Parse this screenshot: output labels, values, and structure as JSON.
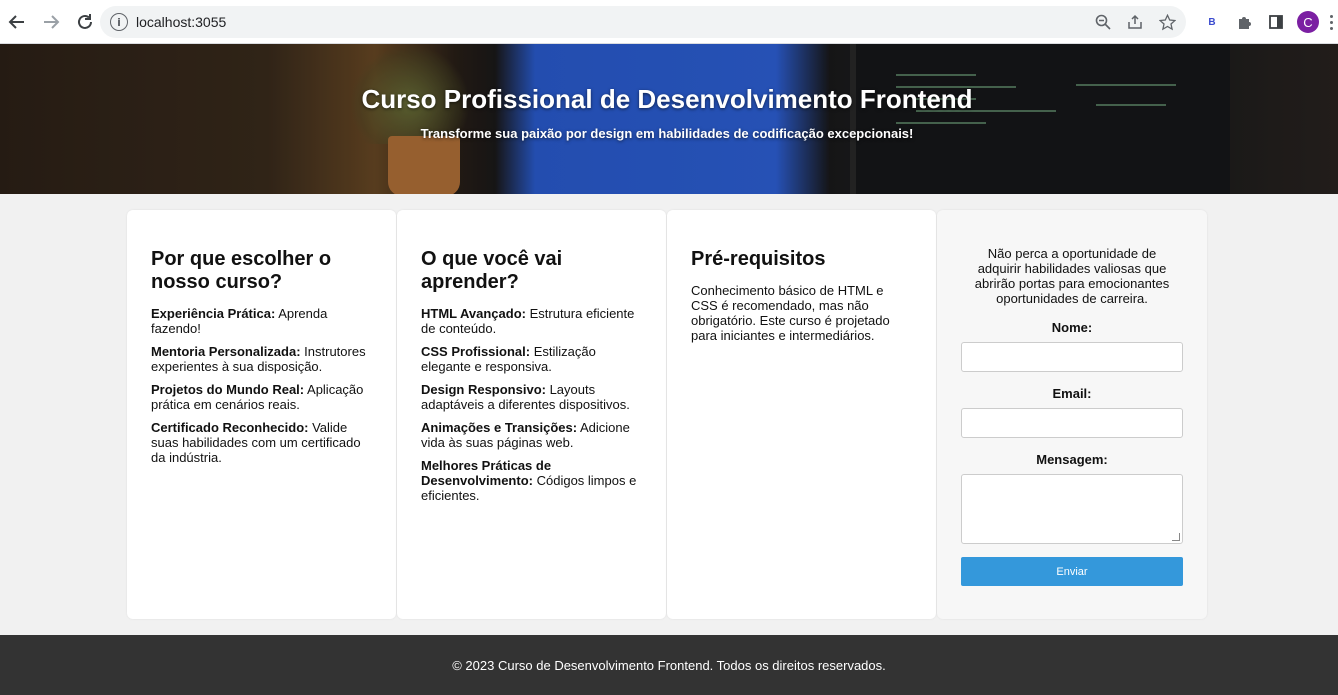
{
  "browser": {
    "url": "localhost:3055",
    "avatar_letter": "C",
    "extension_letter": "B",
    "accent": "#7b1fa2"
  },
  "hero": {
    "title": "Curso Profissional de Desenvolvimento Frontend",
    "subtitle": "Transforme sua paixão por design em habilidades de codificação excepcionais!"
  },
  "cards": [
    {
      "title": "Por que escolher o nosso curso?",
      "items": [
        {
          "bold": "Experiência Prática:",
          "text": " Aprenda fazendo!"
        },
        {
          "bold": "Mentoria Personalizada:",
          "text": " Instrutores experientes à sua disposição."
        },
        {
          "bold": "Projetos do Mundo Real:",
          "text": " Aplicação prática em cenários reais."
        },
        {
          "bold": "Certificado Reconhecido:",
          "text": " Valide suas habilidades com um certificado da indústria."
        }
      ]
    },
    {
      "title": "O que você vai aprender?",
      "items": [
        {
          "bold": "HTML Avançado:",
          "text": " Estrutura eficiente de conteúdo."
        },
        {
          "bold": "CSS Profissional:",
          "text": " Estilização elegante e responsiva."
        },
        {
          "bold": "Design Responsivo:",
          "text": " Layouts adaptáveis a diferentes dispositivos."
        },
        {
          "bold": "Animações e Transições:",
          "text": " Adicione vida às suas páginas web."
        },
        {
          "bold": "Melhores Práticas de Desenvolvimento:",
          "text": " Códigos limpos e eficientes."
        }
      ]
    },
    {
      "title": "Pré-requisitos",
      "text": "Conhecimento básico de HTML e CSS é recomendado, mas não obrigatório. Este curso é projetado para iniciantes e intermediários."
    }
  ],
  "form": {
    "intro": "Não perca a oportunidade de adquirir habilidades valiosas que abrirão portas para emocionantes oportunidades de carreira.",
    "name_label": "Nome:",
    "name_value": "",
    "email_label": "Email:",
    "email_value": "",
    "message_label": "Mensagem:",
    "message_value": "",
    "submit_label": "Enviar",
    "button_color": "#3498db"
  },
  "footer": {
    "text": "© 2023 Curso de Desenvolvimento Frontend. Todos os direitos reservados."
  }
}
